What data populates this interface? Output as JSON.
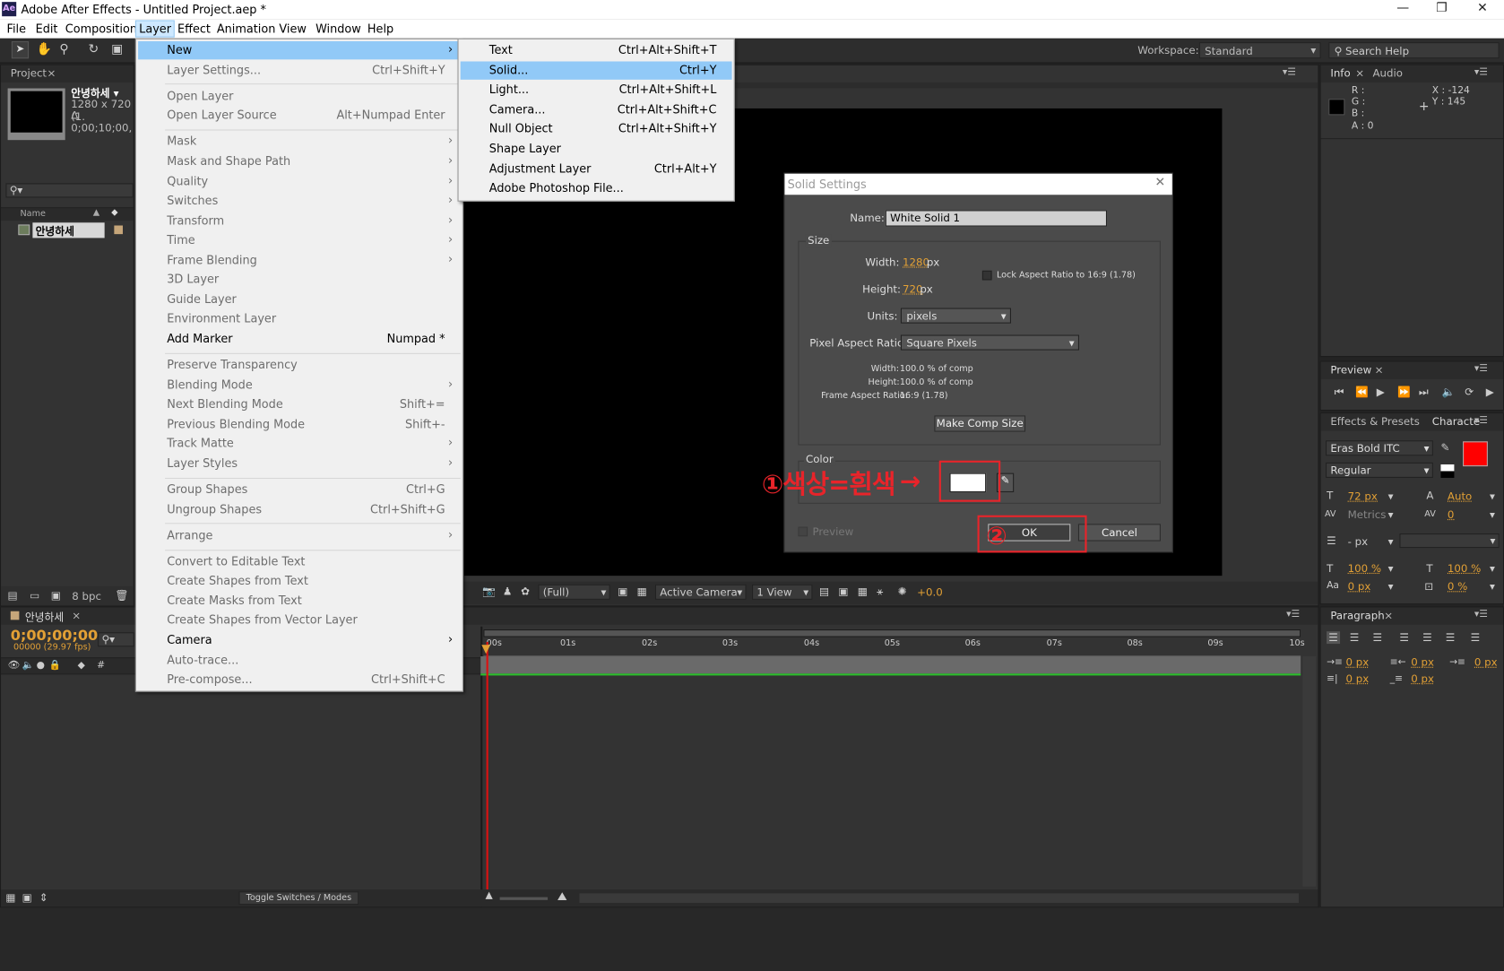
{
  "app": {
    "title": "Adobe After Effects - Untitled Project.aep *",
    "logo": "Ae"
  },
  "menubar": [
    "File",
    "Edit",
    "Composition",
    "Layer",
    "Effect",
    "Animation",
    "View",
    "Window",
    "Help"
  ],
  "toolbar": {
    "workspace_label": "Workspace:",
    "workspace_value": "Standard",
    "search_placeholder": "Search Help"
  },
  "project": {
    "tab": "Project",
    "item_name": "안녕하세 ▾",
    "item_info1": "1280 x 720 (1.",
    "item_info2": "Δ 0;00;10;00,",
    "col_name": "Name",
    "row": "안녕하세",
    "bpc": "8 bpc"
  },
  "layer_menu": [
    {
      "label": "New",
      "arrow": true,
      "hl": true
    },
    {
      "label": "Layer Settings...",
      "shortcut": "Ctrl+Shift+Y",
      "dis": true
    },
    {
      "sep": true
    },
    {
      "label": "Open Layer",
      "dis": true
    },
    {
      "label": "Open Layer Source",
      "shortcut": "Alt+Numpad Enter",
      "dis": true
    },
    {
      "sep": true
    },
    {
      "label": "Mask",
      "arrow": true,
      "dis": true
    },
    {
      "label": "Mask and Shape Path",
      "arrow": true,
      "dis": true
    },
    {
      "label": "Quality",
      "arrow": true,
      "dis": true
    },
    {
      "label": "Switches",
      "arrow": true,
      "dis": true
    },
    {
      "label": "Transform",
      "arrow": true,
      "dis": true
    },
    {
      "label": "Time",
      "arrow": true,
      "dis": true
    },
    {
      "label": "Frame Blending",
      "arrow": true,
      "dis": true
    },
    {
      "label": "3D Layer",
      "dis": true
    },
    {
      "label": "Guide Layer",
      "dis": true
    },
    {
      "label": "Environment Layer",
      "dis": true
    },
    {
      "label": "Add Marker",
      "shortcut": "Numpad *"
    },
    {
      "sep": true
    },
    {
      "label": "Preserve Transparency",
      "dis": true
    },
    {
      "label": "Blending Mode",
      "arrow": true,
      "dis": true
    },
    {
      "label": "Next Blending Mode",
      "shortcut": "Shift+=",
      "dis": true
    },
    {
      "label": "Previous Blending Mode",
      "shortcut": "Shift+-",
      "dis": true
    },
    {
      "label": "Track Matte",
      "arrow": true,
      "dis": true
    },
    {
      "label": "Layer Styles",
      "arrow": true,
      "dis": true
    },
    {
      "sep": true
    },
    {
      "label": "Group Shapes",
      "shortcut": "Ctrl+G",
      "dis": true
    },
    {
      "label": "Ungroup Shapes",
      "shortcut": "Ctrl+Shift+G",
      "dis": true
    },
    {
      "sep": true
    },
    {
      "label": "Arrange",
      "arrow": true,
      "dis": true
    },
    {
      "sep": true
    },
    {
      "label": "Convert to Editable Text",
      "dis": true
    },
    {
      "label": "Create Shapes from Text",
      "dis": true
    },
    {
      "label": "Create Masks from Text",
      "dis": true
    },
    {
      "label": "Create Shapes from Vector Layer",
      "dis": true
    },
    {
      "label": "Camera",
      "arrow": true
    },
    {
      "label": "Auto-trace...",
      "dis": true
    },
    {
      "label": "Pre-compose...",
      "shortcut": "Ctrl+Shift+C",
      "dis": true
    }
  ],
  "new_menu": [
    {
      "label": "Text",
      "shortcut": "Ctrl+Alt+Shift+T"
    },
    {
      "label": "Solid...",
      "shortcut": "Ctrl+Y",
      "hl": true
    },
    {
      "label": "Light...",
      "shortcut": "Ctrl+Alt+Shift+L"
    },
    {
      "label": "Camera...",
      "shortcut": "Ctrl+Alt+Shift+C"
    },
    {
      "label": "Null Object",
      "shortcut": "Ctrl+Alt+Shift+Y"
    },
    {
      "label": "Shape Layer"
    },
    {
      "label": "Adjustment Layer",
      "shortcut": "Ctrl+Alt+Y"
    },
    {
      "label": "Adobe Photoshop File..."
    }
  ],
  "dialog": {
    "title": "Solid Settings",
    "name_label": "Name:",
    "name_value": "White Solid 1",
    "size_label": "Size",
    "width_label": "Width:",
    "width_value": "1280",
    "px": "px",
    "height_label": "Height:",
    "height_value": "720",
    "lock_label": "Lock Aspect Ratio to 16:9 (1.78)",
    "units_label": "Units:",
    "units_value": "pixels",
    "par_label": "Pixel Aspect Ratio:",
    "par_value": "Square Pixels",
    "info_w_label": "Width:",
    "info_w": "100.0 % of comp",
    "info_h_label": "Height:",
    "info_h": "100.0 % of comp",
    "info_far_label": "Frame Aspect Ratio:",
    "info_far": "16:9 (1.78)",
    "make_comp": "Make Comp Size",
    "color_label": "Color",
    "color_value": "#ffffff",
    "preview": "Preview",
    "ok": "OK",
    "cancel": "Cancel"
  },
  "annotations": {
    "step1": "①색상=흰색",
    "step2": "②"
  },
  "viewer": {
    "zoom": "(Full)",
    "camera": "Active Camera",
    "views": "1 View",
    "exposure": "+0.0"
  },
  "info": {
    "tab": "Info",
    "tab2": "Audio",
    "r": "R :",
    "g": "G :",
    "b": "B :",
    "a": "A : 0",
    "x": "X : -124",
    "y": "Y : 145"
  },
  "preview": {
    "tab": "Preview"
  },
  "effects": {
    "tab": "Effects & Presets",
    "tab2": "Characte"
  },
  "character": {
    "font": "Eras Bold ITC",
    "style": "Regular",
    "size": "72 px",
    "leading": "Auto",
    "kerning": "Metrics",
    "tracking": "0",
    "stroke": "- px",
    "vscale": "100 %",
    "hscale": "100 %",
    "baseline": "0 px",
    "tsume": "0 %",
    "color": "#ff0000"
  },
  "paragraph": {
    "tab": "Paragraph",
    "v1": "0 px",
    "v2": "0 px",
    "v3": "0 px",
    "v4": "0 px",
    "v5": "0 px"
  },
  "timeline": {
    "tab": "안녕하세",
    "time": "0;00;00;00",
    "fps": "00000 (29.97 fps)",
    "hash": "#",
    "ticks": [
      "00s",
      "01s",
      "02s",
      "03s",
      "04s",
      "05s",
      "06s",
      "07s",
      "08s",
      "09s",
      "10s"
    ],
    "toggle": "Toggle Switches / Modes"
  }
}
